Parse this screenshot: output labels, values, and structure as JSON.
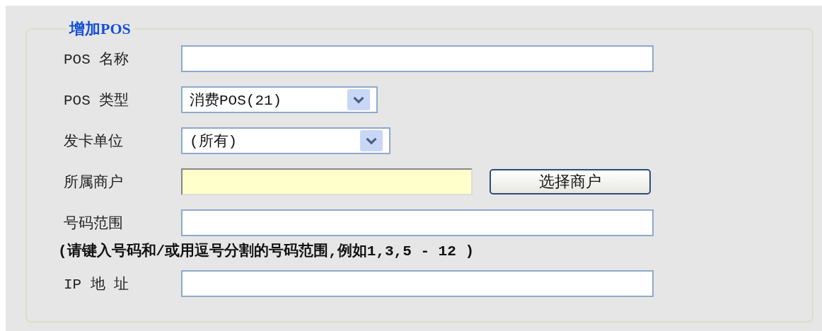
{
  "group": {
    "title": "增加POS"
  },
  "fields": [
    {
      "kind": "text",
      "label": "POS 名称"
    },
    {
      "kind": "select",
      "label": "POS 类型",
      "value": "消费POS(21)"
    },
    {
      "kind": "select",
      "label": "发卡单位",
      "value": "(所有)"
    },
    {
      "kind": "lookup",
      "label": "所属商户",
      "button": "选择商户"
    },
    {
      "kind": "text",
      "label": "号码范围",
      "note": "(请键入号码和/或用逗号分割的号码范围,例如1,3,5 - 12 )"
    },
    {
      "kind": "text",
      "label": "IP 地 址"
    }
  ]
}
